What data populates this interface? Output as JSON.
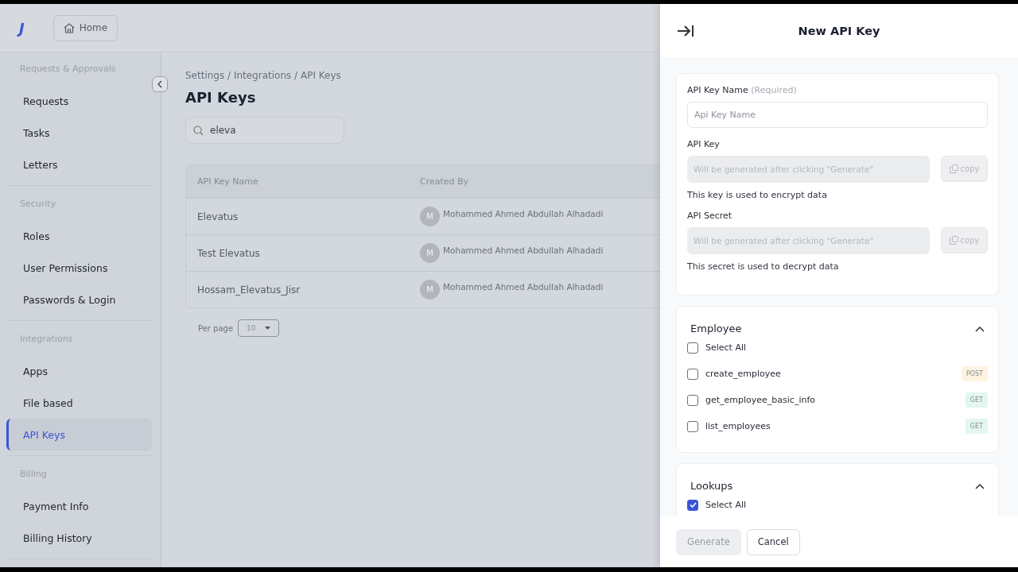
{
  "topbar": {
    "logo": "J",
    "home": "Home"
  },
  "sidebar": {
    "sections": [
      {
        "title": "Requests & Approvals",
        "items": [
          {
            "label": "Requests",
            "selected": false
          },
          {
            "label": "Tasks",
            "selected": false
          },
          {
            "label": "Letters",
            "selected": false
          }
        ]
      },
      {
        "title": "Security",
        "items": [
          {
            "label": "Roles",
            "selected": false
          },
          {
            "label": "User Permissions",
            "selected": false
          },
          {
            "label": "Passwords & Login",
            "selected": false
          }
        ]
      },
      {
        "title": "Integrations",
        "items": [
          {
            "label": "Apps",
            "selected": false
          },
          {
            "label": "File based",
            "selected": false
          },
          {
            "label": "API Keys",
            "selected": true
          }
        ]
      },
      {
        "title": "Billing",
        "items": [
          {
            "label": "Payment Info",
            "selected": false
          },
          {
            "label": "Billing History",
            "selected": false
          }
        ]
      }
    ]
  },
  "main": {
    "breadcrumb": "Settings / Integrations / API Keys",
    "title": "API Keys",
    "search": {
      "value": "eleva"
    },
    "table": {
      "columns": [
        "API Key Name",
        "Created By"
      ],
      "rows": [
        {
          "name": "Elevatus",
          "avatar": "M",
          "created_by": "Mohammed Ahmed Abdullah Alhadadi"
        },
        {
          "name": "Test Elevatus",
          "avatar": "M",
          "created_by": "Mohammed Ahmed Abdullah Alhadadi"
        },
        {
          "name": "Hossam_Elevatus_Jisr",
          "avatar": "M",
          "created_by": "Mohammed Ahmed Abdullah Alhadadi"
        }
      ]
    },
    "per_page": {
      "label": "Per page",
      "value": "10"
    }
  },
  "drawer": {
    "title": "New API Key",
    "name_field": {
      "label": "API Key Name",
      "hint": "(Required)",
      "placeholder": "Api Key Name"
    },
    "secrets": [
      {
        "label": "API Key",
        "placeholder": "Will be generated after clicking \"Generate\"",
        "copy": "copy",
        "help": "This key is used to encrypt data"
      },
      {
        "label": "API Secret",
        "placeholder": "Will be generated after clicking \"Generate\"",
        "copy": "copy",
        "help": "This secret is used to decrypt data"
      }
    ],
    "groups": [
      {
        "title": "Employee",
        "expanded": true,
        "select_all": {
          "label": "Select All",
          "checked": false
        },
        "endpoints": [
          {
            "name": "create_employee",
            "checked": false,
            "method": "POST",
            "color": "#fdf3e1"
          },
          {
            "name": "get_employee_basic_info",
            "checked": false,
            "method": "GET",
            "color": "#e3f6f1"
          },
          {
            "name": "list_employees",
            "checked": false,
            "method": "GET",
            "color": "#e3f6f1"
          }
        ]
      },
      {
        "title": "Lookups",
        "expanded": true,
        "select_all": {
          "label": "Select All",
          "checked": true
        }
      }
    ],
    "buttons": {
      "generate": {
        "label": "Generate",
        "disabled": true
      },
      "cancel": "Cancel"
    }
  }
}
